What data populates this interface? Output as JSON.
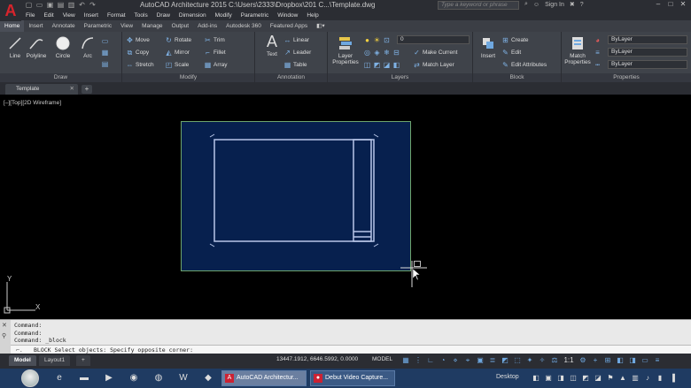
{
  "titlebar": {
    "logo": "A",
    "title": "AutoCAD Architecture 2015    C:\\Users\\2333\\Dropbox\\201 C...\\Template.dwg",
    "search_placeholder": "Type a keyword or phrase",
    "sign_in": "Sign In",
    "minimize": "–",
    "maximize": "□",
    "close": "✕"
  },
  "menubar": [
    "File",
    "Edit",
    "View",
    "Insert",
    "Format",
    "Tools",
    "Draw",
    "Dimension",
    "Modify",
    "Parametric",
    "Window",
    "Help"
  ],
  "ribbon_tabs": [
    "Home",
    "Insert",
    "Annotate",
    "Parametric",
    "View",
    "Manage",
    "Output",
    "Add-ins",
    "Autodesk 360",
    "Featured Apps"
  ],
  "ribbon": {
    "draw": {
      "label": "Draw",
      "line": "Line",
      "polyline": "Polyline",
      "circle": "Circle",
      "arc": "Arc"
    },
    "modify": {
      "label": "Modify",
      "move": "Move",
      "rotate": "Rotate",
      "trim": "Trim",
      "copy": "Copy",
      "mirror": "Mirror",
      "fillet": "Fillet",
      "stretch": "Stretch",
      "scale": "Scale",
      "array": "Array"
    },
    "annotation": {
      "label": "Annotation",
      "text": "Text",
      "linear": "Linear",
      "leader": "Leader",
      "table": "Table"
    },
    "layers": {
      "label": "Layers",
      "layer_properties": "Layer Properties",
      "layer_value": "0",
      "make_current": "Make Current",
      "match_layer": "Match Layer"
    },
    "block": {
      "label": "Block",
      "insert": "Insert",
      "create": "Create",
      "edit": "Edit",
      "edit_attributes": "Edit Attributes"
    },
    "properties": {
      "label": "Properties",
      "match_properties": "Match Properties",
      "color": "ByLayer",
      "linetype": "ByLayer",
      "lineweight": "ByLayer"
    }
  },
  "file_tabs": {
    "active": "Template",
    "plus": "+"
  },
  "viewport": {
    "label": "[–][Top][2D Wireframe]"
  },
  "ucs": {
    "y": "Y",
    "x": "X"
  },
  "command": {
    "history": [
      "Command:",
      "Command:",
      "Command: _block"
    ],
    "prompt": "BLOCK Select objects: Specify opposite corner:"
  },
  "layout_tabs": [
    "Model",
    "Layout1"
  ],
  "status": {
    "coords": "13447.1912, 6646.5992, 0.0000",
    "model": "MODEL",
    "scale": "1:1"
  },
  "taskbar": {
    "tasks": [
      "AutoCAD Architectur...",
      "Debut Video Capture..."
    ],
    "desktop": "Desktop"
  }
}
